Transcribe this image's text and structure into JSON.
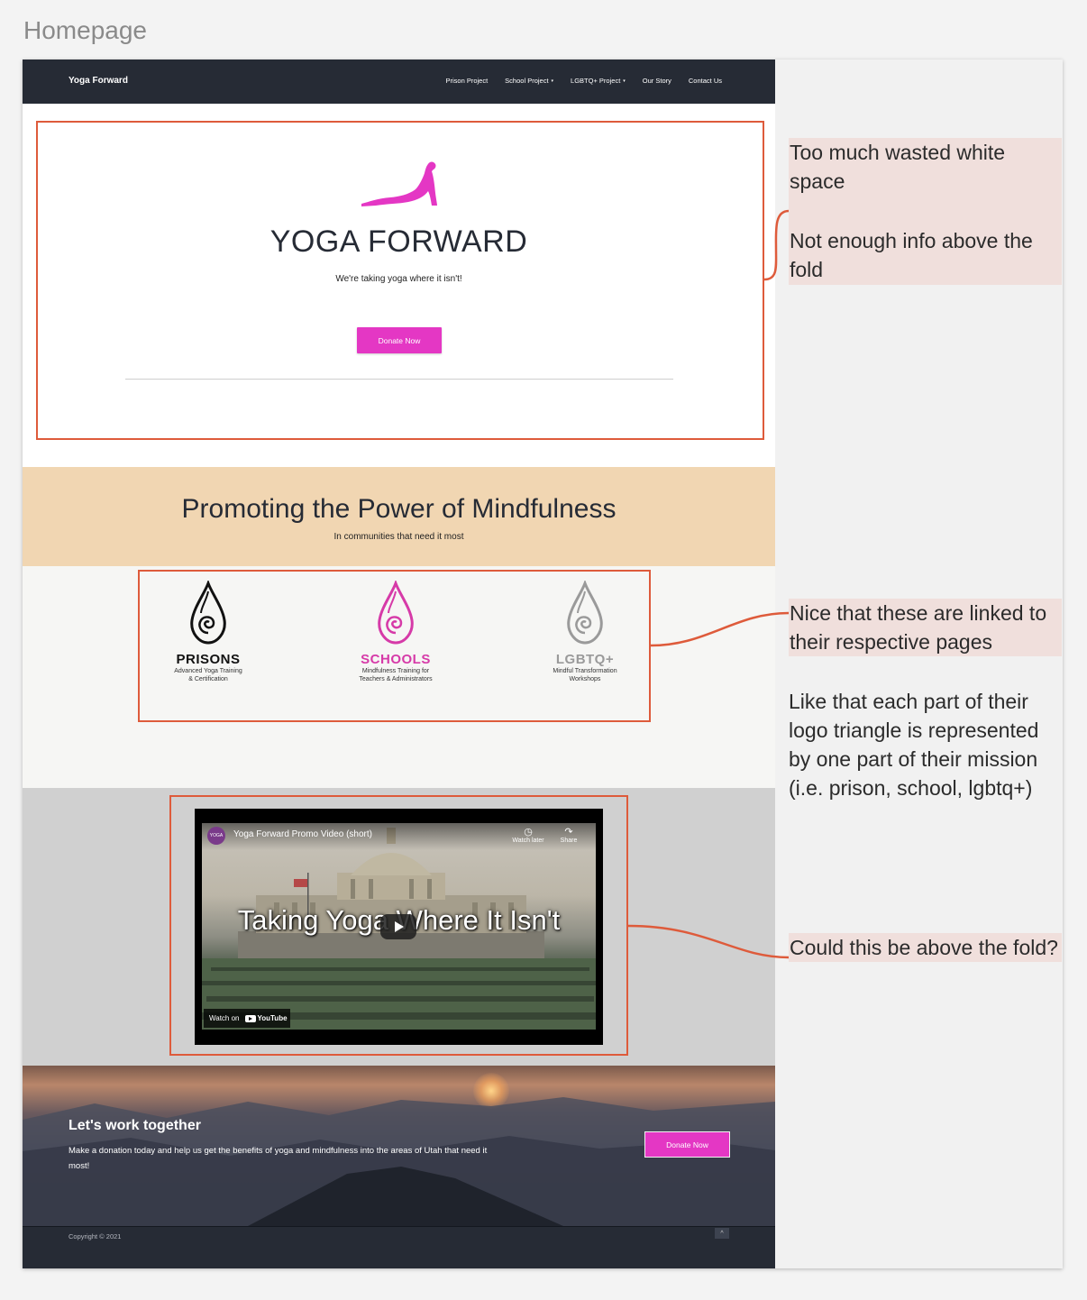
{
  "board": {
    "title": "Homepage"
  },
  "nav": {
    "brand": "Yoga Forward",
    "items": [
      {
        "label": "Prison Project",
        "dropdown": false
      },
      {
        "label": "School Project",
        "dropdown": true
      },
      {
        "label": "LGBTQ+ Project",
        "dropdown": true
      },
      {
        "label": "Our Story",
        "dropdown": false
      },
      {
        "label": "Contact Us",
        "dropdown": false
      }
    ],
    "caret": "▾"
  },
  "hero": {
    "title": "YOGA FORWARD",
    "tagline": "We're taking yoga where it isn't!",
    "donate_label": "Donate Now"
  },
  "band": {
    "title": "Promoting the Power of Mindfulness",
    "subtitle": "In communities that need it most"
  },
  "programs": [
    {
      "name": "PRISONS",
      "desc1": "Advanced Yoga Training",
      "desc2": "& Certification",
      "color": "#111111"
    },
    {
      "name": "SCHOOLS",
      "desc1": "Mindfulness Training for",
      "desc2": "Teachers & Administrators",
      "color": "#d63aa8"
    },
    {
      "name": "LGBTQ+",
      "desc1": "Mindful Transformation",
      "desc2": "Workshops",
      "color": "#9a9a9a"
    }
  ],
  "video": {
    "channel_avatar": "YOGA",
    "title": "Yoga Forward Promo Video (short)",
    "watch_later": "Watch later",
    "share": "Share",
    "overlay": "Taking Yoga Where It Isn't",
    "watch_on": "Watch on",
    "youtube": "YouTube"
  },
  "cta": {
    "title": "Let's work together",
    "text": "Make a donation today and help us get the benefits of yoga and mindfulness into the areas of Utah that need it most!",
    "donate_label": "Donate Now"
  },
  "footer": {
    "copyright": "Copyright © 2021",
    "to_top": "^"
  },
  "annotations": {
    "hero_note_1": "Too much wasted white space",
    "hero_note_2": "Not enough info above the fold",
    "programs_note_1": "Nice that these are linked to their respective pages",
    "programs_note_2": "Like that each part of their logo triangle is represented by one part of their mission (i.e. prison, school, lgbtq+)",
    "video_note": "Could this be above the fold?"
  },
  "colors": {
    "nav_bg": "#262b35",
    "accent": "#e437c4",
    "band_bg": "#f1d6b2",
    "highlight": "#de5b3b",
    "note_bg": "#f0dfdc"
  }
}
